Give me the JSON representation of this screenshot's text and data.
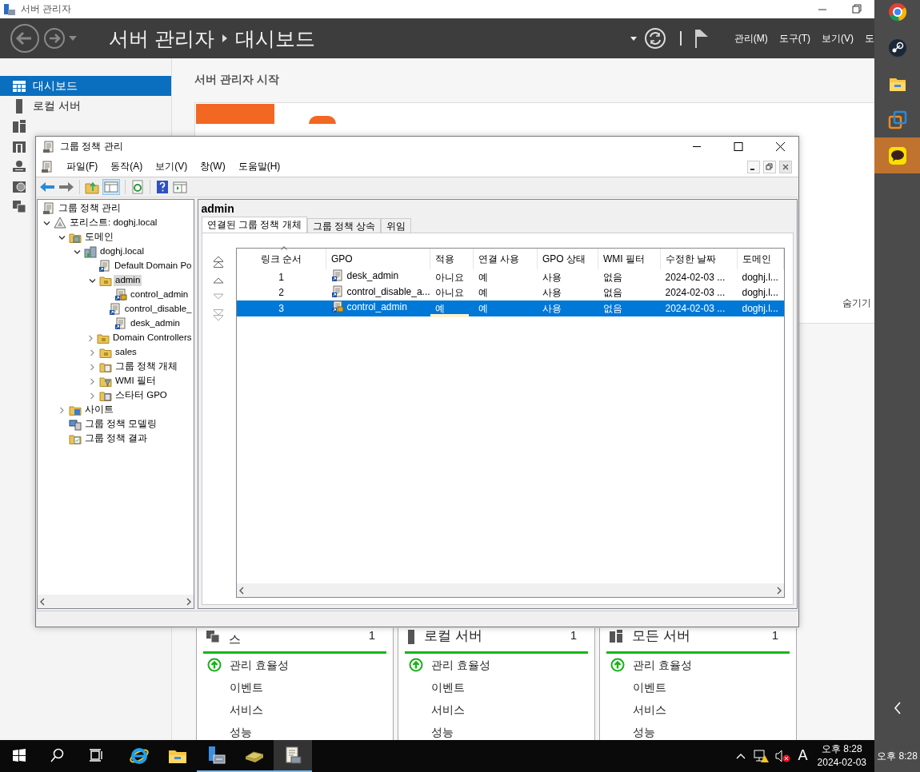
{
  "server_manager": {
    "title": "서버 관리자",
    "breadcrumb": [
      "서버 관리자",
      "대시보드"
    ],
    "menus": [
      "관리(M)",
      "도구(T)",
      "보기(V)",
      "도"
    ],
    "sidebar": [
      {
        "kind": "dashboard",
        "label": "대시보드",
        "selected": true
      },
      {
        "kind": "server",
        "label": "로컬 서버",
        "selected": false
      },
      {
        "kind": "servers",
        "selected": false
      },
      {
        "kind": "building",
        "selected": false
      },
      {
        "kind": "network",
        "selected": false
      },
      {
        "kind": "globe",
        "selected": false
      },
      {
        "kind": "storage",
        "selected": false
      }
    ],
    "welcome": {
      "heading": "서버 관리자 시작",
      "hide_link": "숨기기"
    },
    "tiles": [
      {
        "kind": "storage",
        "title": "스",
        "count": "1",
        "rows": [
          {
            "label": "관리 효율성",
            "ok": true
          },
          {
            "label": "이벤트",
            "ok": false
          },
          {
            "label": "서비스",
            "ok": false
          },
          {
            "label": "성능",
            "ok": false
          }
        ]
      },
      {
        "kind": "server",
        "title": "로컬 서버",
        "count": "1",
        "rows": [
          {
            "label": "관리 효율성",
            "ok": true
          },
          {
            "label": "이벤트",
            "ok": false
          },
          {
            "label": "서비스",
            "ok": false
          },
          {
            "label": "성능",
            "ok": false
          }
        ]
      },
      {
        "kind": "servers",
        "title": "모든 서버",
        "count": "1",
        "rows": [
          {
            "label": "관리 효율성",
            "ok": true
          },
          {
            "label": "이벤트",
            "ok": false
          },
          {
            "label": "서비스",
            "ok": false
          },
          {
            "label": "성능",
            "ok": false
          }
        ]
      }
    ]
  },
  "gpm": {
    "title": "그룹 정책 관리",
    "menus": [
      "파일(F)",
      "동작(A)",
      "보기(V)",
      "창(W)",
      "도움말(H)"
    ],
    "tree": [
      {
        "label": "그룹 정책 관리",
        "kind": "root",
        "selected": false,
        "children": [
          {
            "label": "포리스트: doghj.local",
            "kind": "forest",
            "expanded": true,
            "selected": false,
            "children": [
              {
                "label": "도메인",
                "kind": "domains",
                "expanded": true,
                "selected": false,
                "children": [
                  {
                    "label": "doghj.local",
                    "kind": "domain",
                    "expanded": true,
                    "selected": false,
                    "children": [
                      {
                        "label": "Default Domain Po",
                        "kind": "gpo-link",
                        "selected": false
                      },
                      {
                        "label": "admin",
                        "kind": "ou",
                        "expanded": true,
                        "selected": true,
                        "children": [
                          {
                            "label": "control_admin",
                            "kind": "gpo-link-locked",
                            "selected": false
                          },
                          {
                            "label": "control_disable_",
                            "kind": "gpo-link",
                            "selected": false
                          },
                          {
                            "label": "desk_admin",
                            "kind": "gpo-link",
                            "selected": false
                          }
                        ]
                      },
                      {
                        "label": "Domain Controllers",
                        "kind": "ou",
                        "expanded": false,
                        "selected": false
                      },
                      {
                        "label": "sales",
                        "kind": "ou",
                        "expanded": false,
                        "selected": false
                      },
                      {
                        "label": "그룹 정책 개체",
                        "kind": "gpo-container",
                        "expanded": false,
                        "selected": false
                      },
                      {
                        "label": "WMI 필터",
                        "kind": "wmi-container",
                        "expanded": false,
                        "selected": false
                      },
                      {
                        "label": "스타터 GPO",
                        "kind": "starter-container",
                        "expanded": false,
                        "selected": false
                      }
                    ]
                  }
                ]
              },
              {
                "label": "사이트",
                "kind": "sites",
                "expanded": false,
                "selected": false
              },
              {
                "label": "그룹 정책 모델링",
                "kind": "modeling",
                "selected": false
              },
              {
                "label": "그룹 정책 결과",
                "kind": "results",
                "selected": false
              }
            ]
          }
        ]
      }
    ],
    "pane_title": "admin",
    "tabs": [
      {
        "label": "연결된 그룹 정책 개체",
        "selected": true
      },
      {
        "label": "그룹 정책 상속",
        "selected": false
      },
      {
        "label": "위임",
        "selected": false
      }
    ],
    "table": {
      "columns": [
        "링크 순서",
        "GPO",
        "적용",
        "연결 사용",
        "GPO 상태",
        "WMI 필터",
        "수정한 날짜",
        "도메인"
      ],
      "rows": [
        {
          "cells": [
            "1",
            "desk_admin",
            "아니요",
            "예",
            "사용",
            "없음",
            "2024-02-03 ...",
            "doghj.l..."
          ],
          "kind": "gpo-link",
          "selected": false,
          "annotated": false
        },
        {
          "cells": [
            "2",
            "control_disable_a...",
            "아니요",
            "예",
            "사용",
            "없음",
            "2024-02-03 ...",
            "doghj.l..."
          ],
          "kind": "gpo-link",
          "selected": false,
          "annotated": false
        },
        {
          "cells": [
            "3",
            "control_admin",
            "예",
            "예",
            "사용",
            "없음",
            "2024-02-03 ...",
            "doghj.l..."
          ],
          "kind": "gpo-link-locked",
          "selected": true,
          "annotated": true
        }
      ]
    }
  },
  "taskbar": {
    "apps": [
      {
        "kind": "ie",
        "running": false,
        "selected": false
      },
      {
        "kind": "explorer",
        "running": false,
        "selected": false
      },
      {
        "kind": "server-manager",
        "running": true,
        "selected": false
      },
      {
        "kind": "drive",
        "running": true,
        "selected": false
      },
      {
        "kind": "gpm",
        "running": true,
        "selected": true
      }
    ],
    "ime": "A",
    "time": "오후 8:28",
    "date": "2024-02-03"
  },
  "side_strip": {
    "apps": [
      {
        "kind": "chrome",
        "selected": false
      },
      {
        "kind": "steam",
        "selected": false
      },
      {
        "kind": "explorer",
        "selected": false
      },
      {
        "kind": "vm",
        "selected": false
      },
      {
        "kind": "chat",
        "selected": true
      }
    ],
    "time": "오후 8:28"
  }
}
